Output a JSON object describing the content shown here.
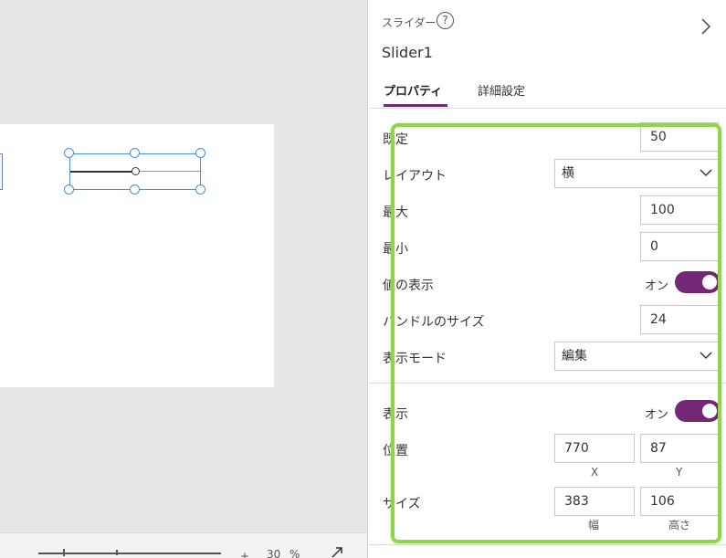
{
  "canvas": {
    "zoom": {
      "level": "30",
      "unit": "%",
      "plus": "+"
    }
  },
  "panel": {
    "control_type": "スライダー",
    "control_name": "Slider1",
    "help_icon": "?",
    "tabs": [
      {
        "label": "プロパティ",
        "active": true
      },
      {
        "label": "詳細設定",
        "active": false
      }
    ],
    "properties": {
      "default": {
        "label": "既定",
        "value": "50"
      },
      "layout": {
        "label": "レイアウト",
        "value": "横"
      },
      "max": {
        "label": "最大",
        "value": "100"
      },
      "min": {
        "label": "最小",
        "value": "0"
      },
      "show_value": {
        "label": "値の表示",
        "state": "オン"
      },
      "handle_size": {
        "label": "ハンドルのサイズ",
        "value": "24"
      },
      "display_mode": {
        "label": "表示モード",
        "value": "編集"
      },
      "visible": {
        "label": "表示",
        "state": "オン"
      },
      "position": {
        "label": "位置",
        "x": "770",
        "y": "87",
        "x_label": "X",
        "y_label": "Y"
      },
      "size": {
        "label": "サイズ",
        "width": "383",
        "height": "106",
        "width_label": "幅",
        "height_label": "高さ"
      }
    }
  },
  "colors": {
    "accent": "#742774",
    "highlight": "#8fd44a",
    "selection": "#4a90d9"
  }
}
